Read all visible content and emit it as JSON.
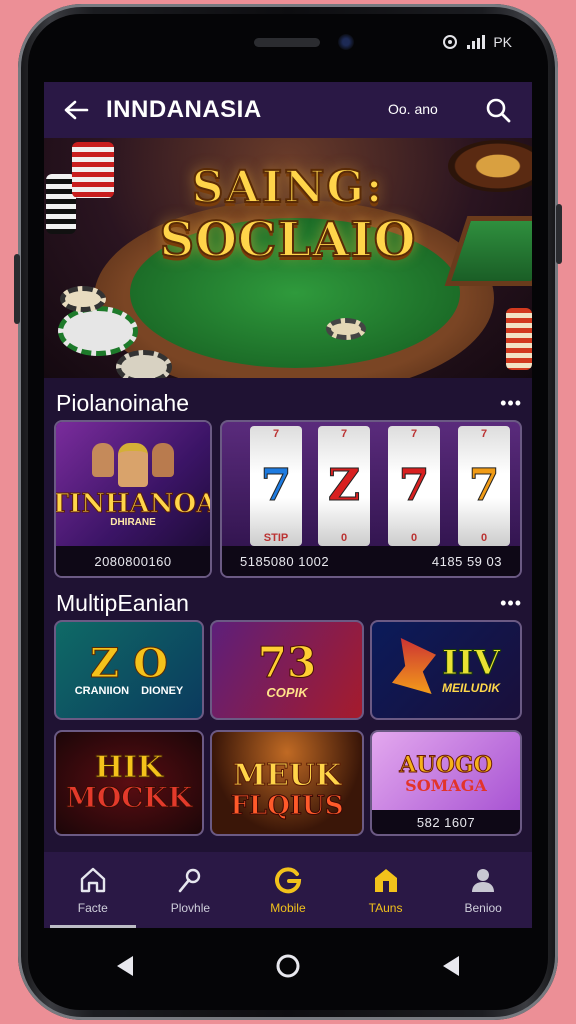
{
  "status": {
    "carrier": "PK"
  },
  "header": {
    "title": "INNDANASIA",
    "balance": "Oo. ano"
  },
  "banner": {
    "title_line1": "SAING:",
    "title_line2": "SOCLAIO"
  },
  "section1": {
    "title": "Piolanoinahe",
    "cards": [
      {
        "art_title": "TINHANOA",
        "art_sub": "DHIRANE",
        "value": "2080800160"
      },
      {
        "art_title": "",
        "reel_text": "STIP",
        "value": "5185080 1002"
      },
      {
        "art_title": "",
        "value": "4185 59 03"
      }
    ]
  },
  "section2": {
    "title": "MultipEanian",
    "cards": [
      {
        "art_title": "Z O",
        "art_sub1": "CRANIION",
        "art_sub2": "DIONEY"
      },
      {
        "art_title": "73",
        "art_sub": "COPIK"
      },
      {
        "art_title": "IIV",
        "art_sub": "MEILUDIK"
      },
      {
        "art_title": "HIK",
        "art_sub": "MOCKK"
      },
      {
        "art_title": "MEUK",
        "art_sub": "FLQIUS"
      },
      {
        "art_title": "AUOGO",
        "art_sub": "SOMAGA",
        "value": "582 1607"
      }
    ]
  },
  "nav": {
    "items": [
      {
        "label": "Facte"
      },
      {
        "label": "Plovhle"
      },
      {
        "label": "Mobile"
      },
      {
        "label": "TAuns"
      },
      {
        "label": "Benioo"
      }
    ]
  },
  "colors": {
    "accent": "#f2c21b",
    "nav_bg": "#2a1845",
    "screen_bg": "#1f1233"
  }
}
